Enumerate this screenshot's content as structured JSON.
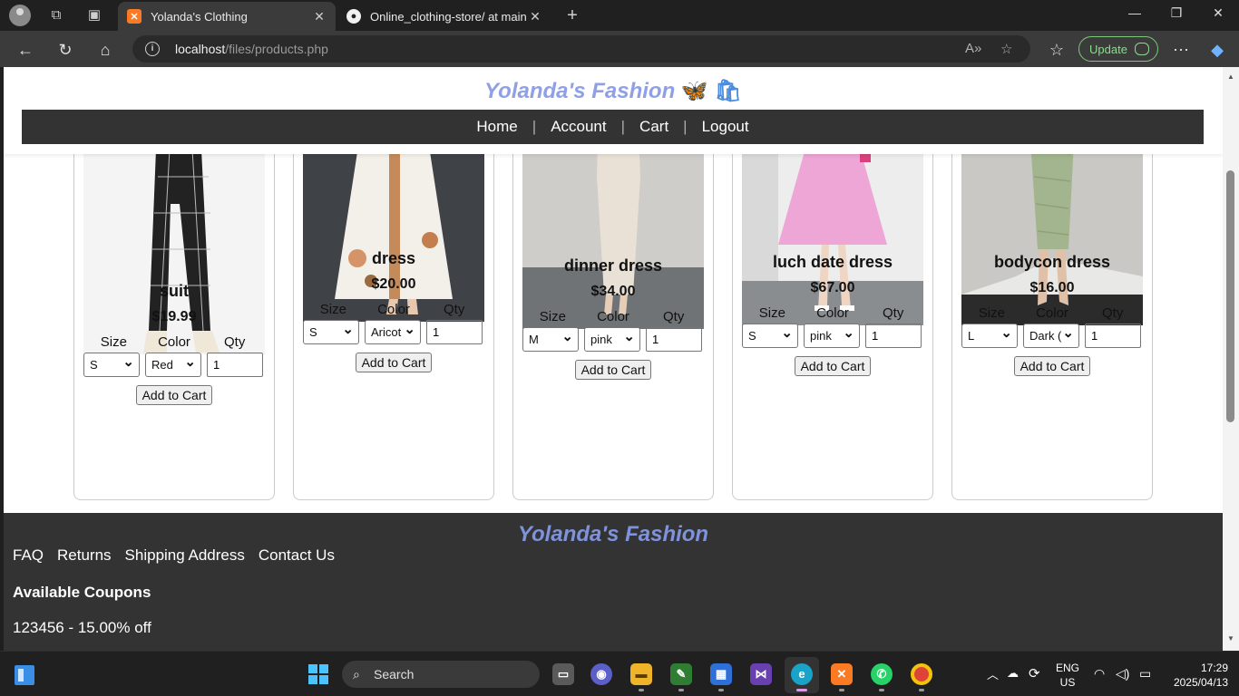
{
  "browser": {
    "tabs": [
      {
        "title": "Yolanda's Clothing",
        "active": true
      },
      {
        "title": "Online_clothing-store/ at main · Y",
        "active": false
      }
    ],
    "url_host": "localhost",
    "url_path": "/files/products.php",
    "update_label": "Update"
  },
  "site": {
    "brand": "Yolanda's Fashion",
    "brand_emoji": "🦋 🛍",
    "nav": [
      "Home",
      "Account",
      "Cart",
      "Logout"
    ]
  },
  "labels": {
    "size": "Size",
    "color": "Color",
    "qty": "Qty",
    "add_to_cart": "Add to Cart"
  },
  "products": [
    {
      "name": "suit",
      "price": "$19.99",
      "size": "S",
      "color": "Red",
      "qty": "1"
    },
    {
      "name": "dress",
      "price": "$20.00",
      "size": "S",
      "color": "Aricot",
      "qty": "1"
    },
    {
      "name": "dinner dress",
      "price": "$34.00",
      "size": "M",
      "color": "pink",
      "qty": "1"
    },
    {
      "name": "luch date dress",
      "price": "$67.00",
      "size": "S",
      "color": "pink",
      "qty": "1"
    },
    {
      "name": "bodycon dress",
      "price": "$16.00",
      "size": "L",
      "color": "Dark (",
      "qty": "1"
    }
  ],
  "footer": {
    "brand": "Yolanda's Fashion",
    "links": [
      "FAQ",
      "Returns",
      "Shipping Address",
      "Contact Us"
    ],
    "coupons_heading": "Available Coupons",
    "coupon": "123456 - 15.00% off"
  },
  "taskbar": {
    "search_label": "Search",
    "lang_1": "ENG",
    "lang_2": "US",
    "time": "17:29",
    "date": "2025/04/13"
  }
}
